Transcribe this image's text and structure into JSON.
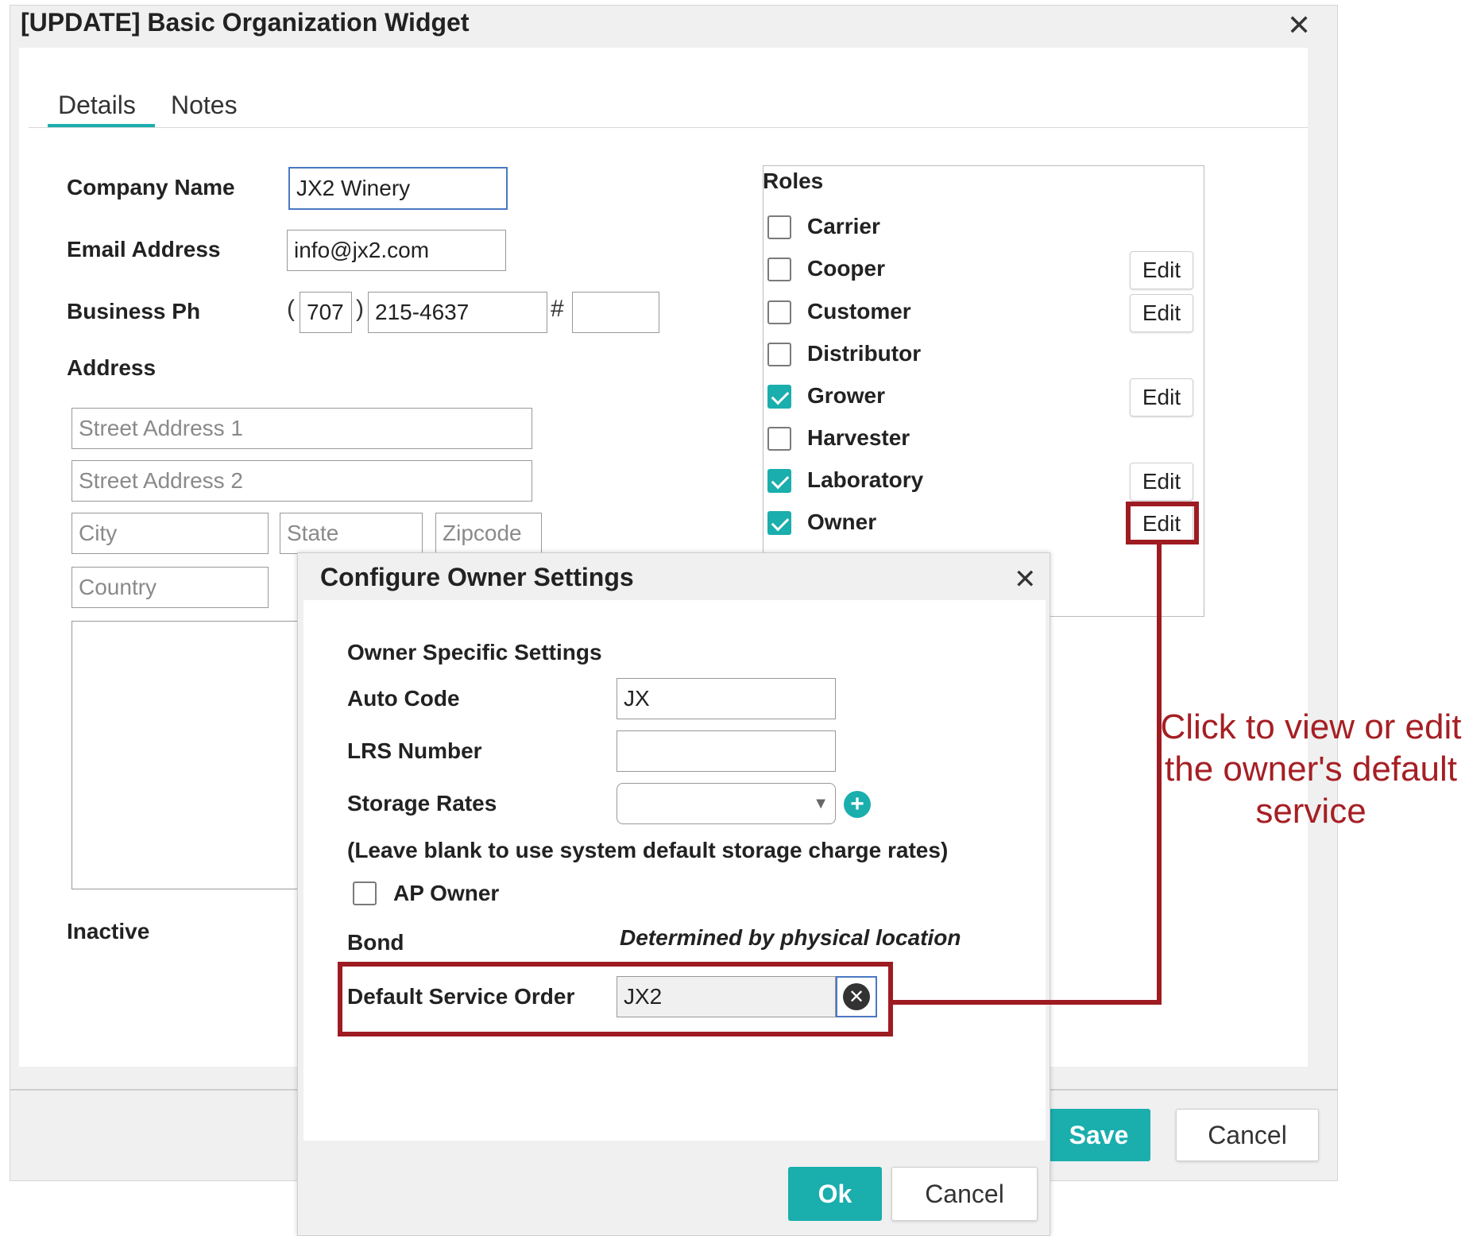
{
  "main": {
    "title": "[UPDATE] Basic Organization Widget",
    "close_icon": "close-icon",
    "tabs": [
      {
        "label": "Details"
      },
      {
        "label": "Notes"
      }
    ],
    "form": {
      "company_name_label": "Company Name",
      "company_name_value": "JX2 Winery",
      "email_label": "Email Address",
      "email_value": "info@jx2.com",
      "phone_label": "Business Ph",
      "phone_area_open": "(",
      "phone_area": "707",
      "phone_area_close": ")",
      "phone_number": "215-4637",
      "phone_ext_hash": "#",
      "phone_ext": "",
      "address_label": "Address",
      "street1_placeholder": "Street Address 1",
      "street2_placeholder": "Street Address 2",
      "city_placeholder": "City",
      "state_placeholder": "State",
      "zip_placeholder": "Zipcode",
      "country_placeholder": "Country",
      "inactive_label": "Inactive"
    },
    "roles": {
      "title": "Roles",
      "edit_label": "Edit",
      "items": [
        {
          "label": "Carrier",
          "checked": false,
          "editable": false
        },
        {
          "label": "Cooper",
          "checked": false,
          "editable": true
        },
        {
          "label": "Customer",
          "checked": false,
          "editable": true
        },
        {
          "label": "Distributor",
          "checked": false,
          "editable": false
        },
        {
          "label": "Grower",
          "checked": true,
          "editable": true
        },
        {
          "label": "Harvester",
          "checked": false,
          "editable": false
        },
        {
          "label": "Laboratory",
          "checked": true,
          "editable": true
        },
        {
          "label": "Owner",
          "checked": true,
          "editable": true
        }
      ]
    },
    "footer": {
      "save_label": "Save",
      "cancel_label": "Cancel"
    }
  },
  "dialog": {
    "title": "Configure Owner Settings",
    "close_icon": "close-icon",
    "section_title": "Owner Specific Settings",
    "auto_code_label": "Auto Code",
    "auto_code_value": "JX",
    "lrs_label": "LRS Number",
    "lrs_value": "",
    "storage_rates_label": "Storage Rates",
    "storage_rates_value": "",
    "storage_rates_hint": "(Leave blank to use system default storage charge rates)",
    "ap_owner_label": "AP Owner",
    "ap_owner_checked": false,
    "bond_label": "Bond",
    "bond_value": "Determined by physical location",
    "default_service_label": "Default Service Order",
    "default_service_value": "JX2",
    "ok_label": "Ok",
    "cancel_label": "Cancel"
  },
  "annotation": {
    "text": "Click to view or edit the owner's default service",
    "color": "#9e1b22"
  },
  "colors": {
    "accent": "#1aaead",
    "focus": "#4a78c2"
  }
}
